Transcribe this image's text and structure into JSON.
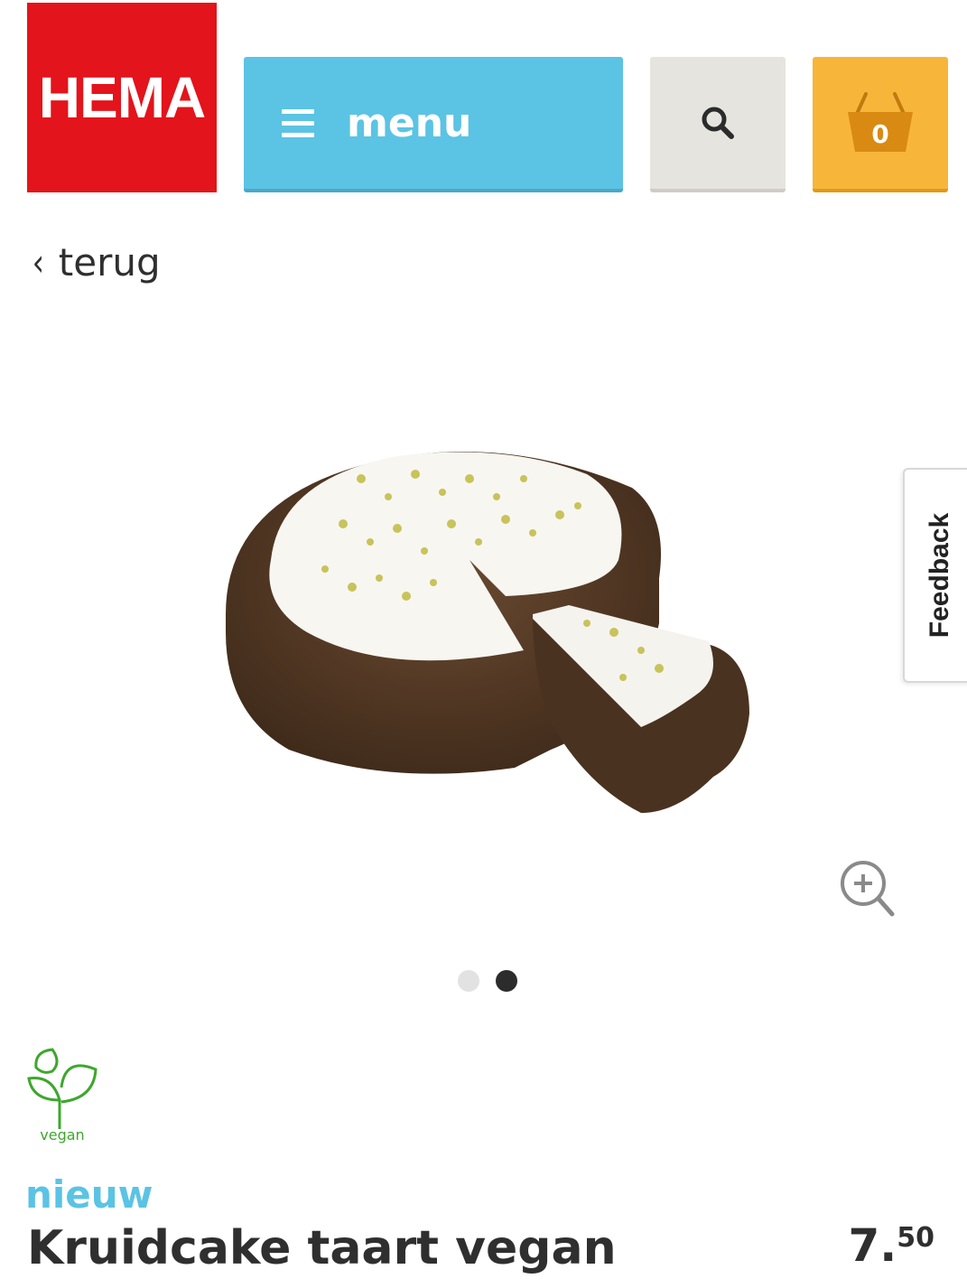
{
  "header": {
    "logo_text": "HEMA",
    "menu_label": "menu",
    "search_icon": "search-icon",
    "cart_count": "0",
    "colors": {
      "logo": "#e3141b",
      "menu": "#5bc3e4",
      "search": "#e6e4df",
      "cart": "#f7b63a"
    }
  },
  "nav": {
    "back_label": "terug"
  },
  "gallery": {
    "slide_count": 2,
    "active_slide": 2
  },
  "feedback_tab": {
    "label": "Feedback"
  },
  "product": {
    "badge_label": "vegan",
    "tag": "nieuw",
    "title": "Kruidcake taart vegan",
    "price_euros": "7",
    "price_cents": "50"
  }
}
